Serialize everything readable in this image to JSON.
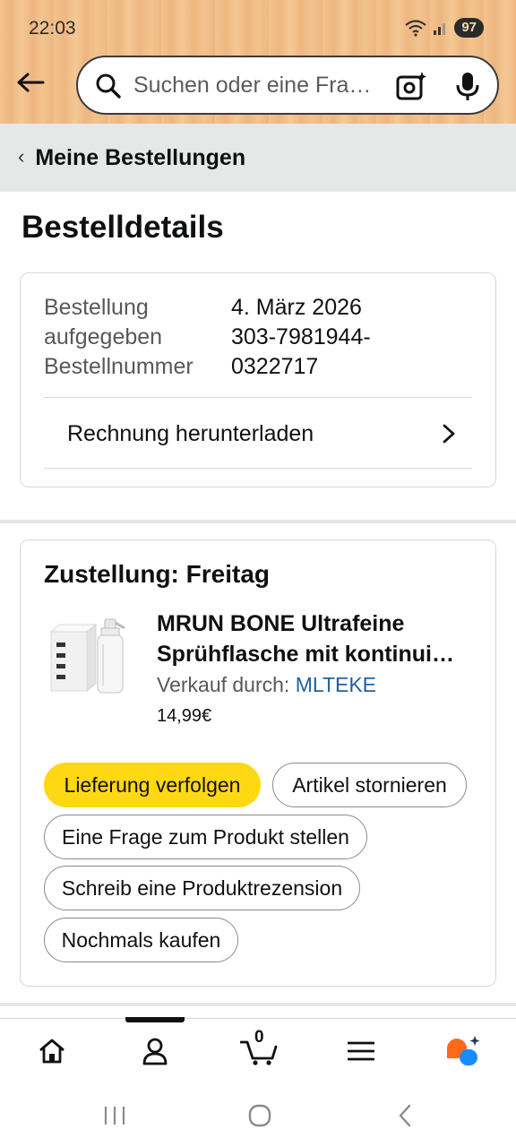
{
  "status_bar": {
    "time": "22:03",
    "battery": "97",
    "icons": [
      "wifi-icon",
      "signal-icon",
      "battery-icon"
    ]
  },
  "header": {
    "search_placeholder": "Suchen oder eine Fra…",
    "icons": [
      "back-arrow-icon",
      "search-icon",
      "camera-icon",
      "microphone-icon"
    ]
  },
  "breadcrumb": {
    "label": "Meine Bestellungen"
  },
  "page": {
    "title": "Bestelldetails"
  },
  "order_info": {
    "placed_label_1": "Bestellung",
    "placed_label_2": "aufgegeben",
    "number_label": "Bestellnummer",
    "placed_date": "4. März 2026",
    "number_line_1": "303-7981944-",
    "number_line_2": "0322717",
    "invoice_label": "Rechnung herunterladen"
  },
  "delivery": {
    "title": "Zustellung: Freitag",
    "product_title_1": "MRUN BONE Ultrafeine",
    "product_title_2": "Sprühflasche mit kontinui…",
    "seller_prefix": "Verkauf durch: ",
    "seller_name": "MLTEKE",
    "price": "14,99€"
  },
  "actions": {
    "track": "Lieferung verfolgen",
    "cancel": "Artikel stornieren",
    "question": "Eine Frage zum Produkt stellen",
    "review": "Schreib eine Produktrezension",
    "buy_again": "Nochmals kaufen"
  },
  "bottom_nav": {
    "cart_count": "0",
    "items": [
      "home-icon",
      "account-icon",
      "cart-icon",
      "menu-icon",
      "rufus-icon"
    ]
  },
  "colors": {
    "primary_button": "#ffd814",
    "link": "#2162a1",
    "header_bg": "#f0bd86"
  }
}
